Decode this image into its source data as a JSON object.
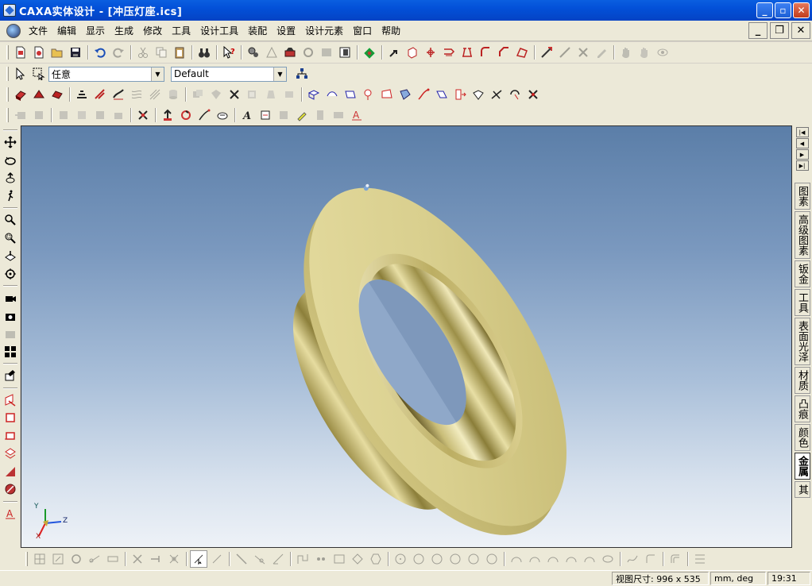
{
  "window": {
    "title": "CAXA实体设计 - [冲压灯座.ics]",
    "minimize": "_",
    "maximize": "▫",
    "close": "✕"
  },
  "menubar": {
    "items": [
      "文件",
      "编辑",
      "显示",
      "生成",
      "修改",
      "工具",
      "设计工具",
      "装配",
      "设置",
      "设计元素",
      "窗口",
      "帮助"
    ],
    "mdi_minimize": "_",
    "mdi_restore": "❐",
    "mdi_close": "✕"
  },
  "selection_toolbar": {
    "filter_value": "任意",
    "view_value": "Default"
  },
  "right_panel": {
    "tabs": [
      "图素",
      "高级图素",
      "钣金",
      "工具",
      "表面光泽",
      "材质",
      "凸痕",
      "颜色",
      "金属",
      "其"
    ],
    "active_tab": "金属"
  },
  "triad": {
    "x_label": "X",
    "y_label": "Y",
    "z_label": "Z"
  },
  "statusbar": {
    "view_size": "视图尺寸:  996 x 535",
    "units": "mm, deg",
    "time": "19:31"
  },
  "colors": {
    "titlebar": "#0450d0",
    "chrome": "#ece9d8",
    "model_gold": "#c9bd7a"
  }
}
